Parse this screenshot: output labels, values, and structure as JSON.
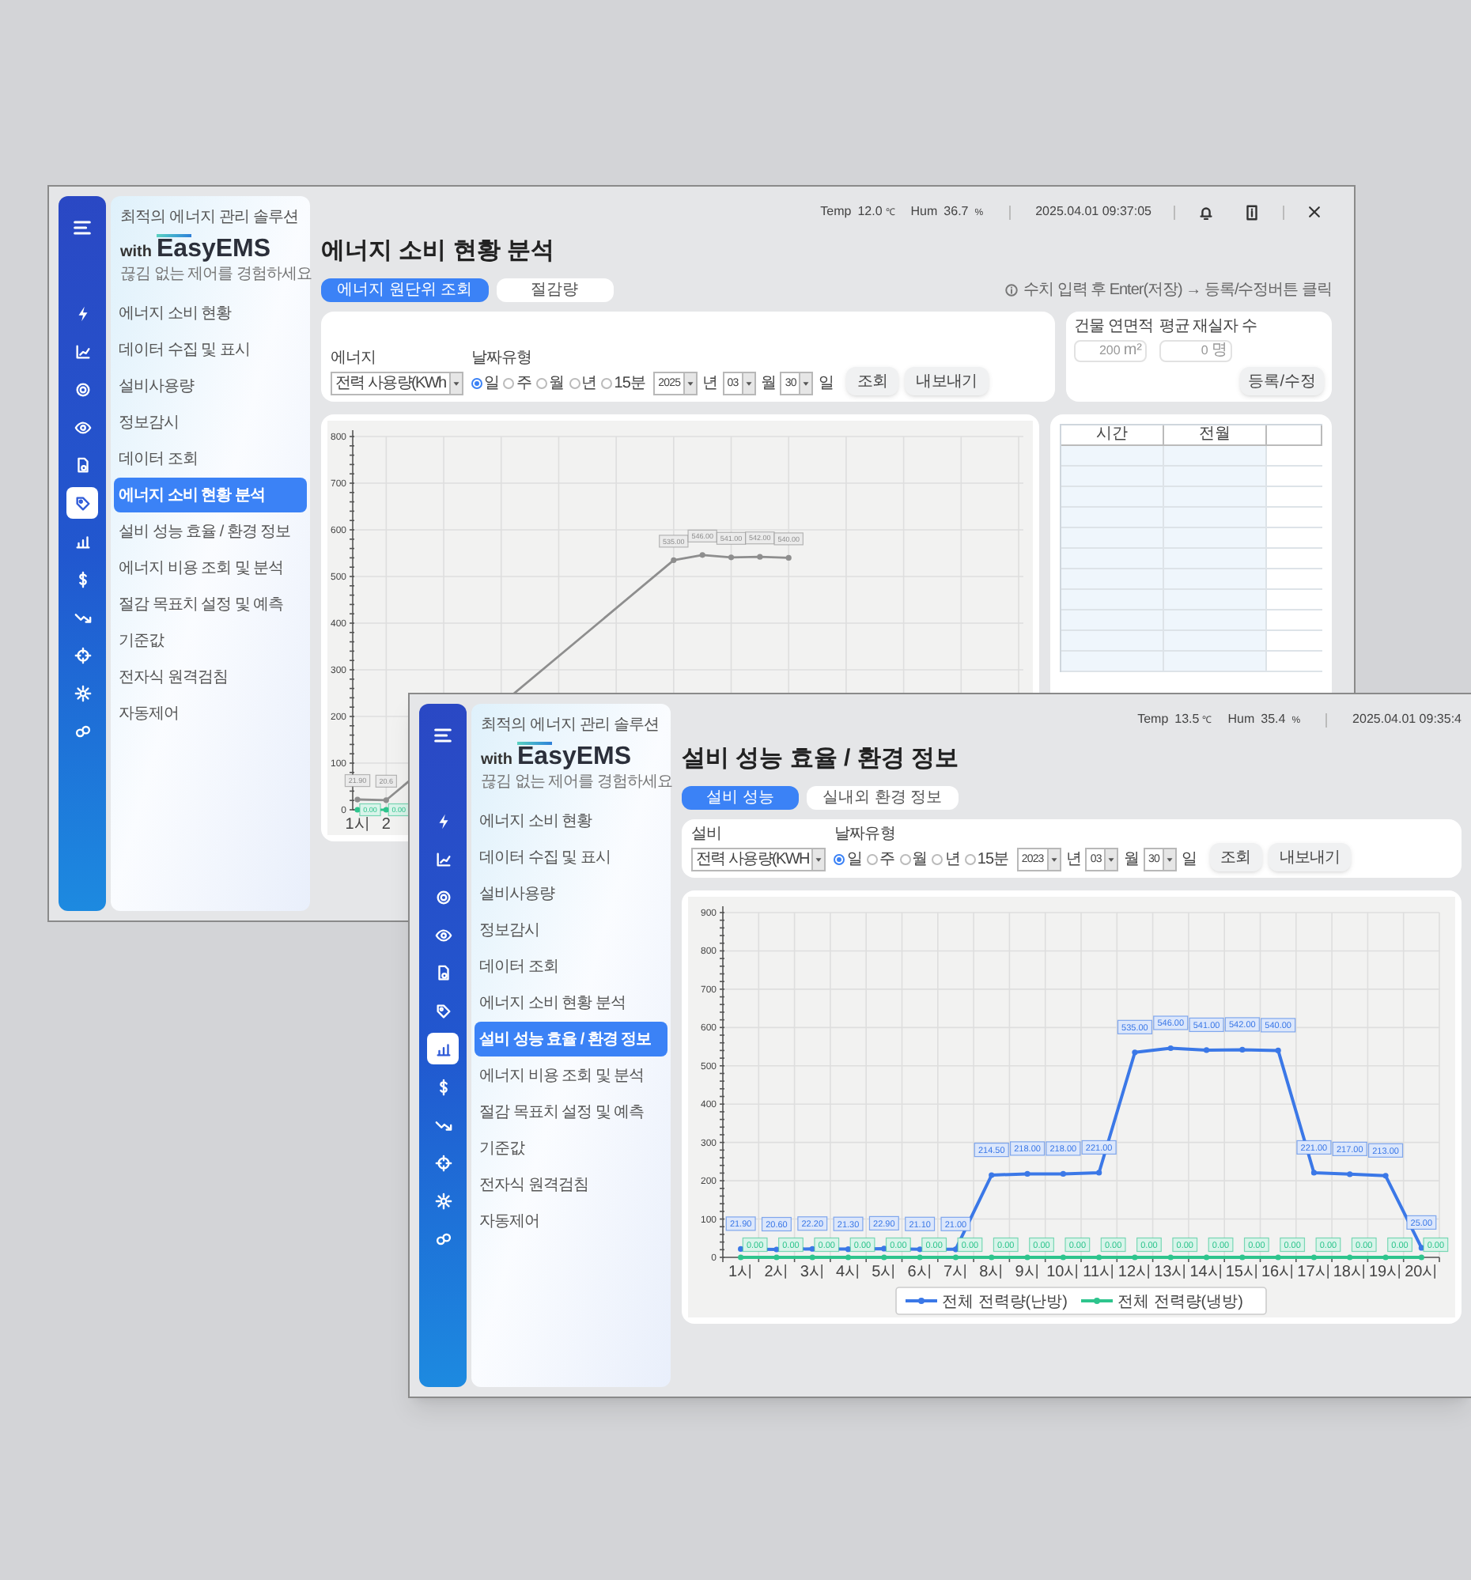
{
  "windows": [
    {
      "kind": "back",
      "status": {
        "temp_label": "Temp",
        "temp": "12.0",
        "temp_unit": "℃",
        "hum_label": "Hum",
        "hum": "36.7",
        "hum_unit": "%",
        "datetime": "2025.04.01 09:37:05"
      },
      "sidebar": {
        "tagline": "최적의 에너지 관리 솔루션",
        "logo_prefix": "with",
        "logo": "EasyEMS",
        "slogan": "끊김 없는 제어를 경험하세요",
        "items": [
          {
            "label": "에너지 소비 현황",
            "selected": false
          },
          {
            "label": "데이터 수집 및 표시",
            "selected": false
          },
          {
            "label": "설비사용량",
            "selected": false
          },
          {
            "label": "정보감시",
            "selected": false
          },
          {
            "label": "데이터 조회",
            "selected": false
          },
          {
            "label": "에너지 소비 현황 분석",
            "selected": true
          },
          {
            "label": "설비 성능 효율 / 환경 정보",
            "selected": false
          },
          {
            "label": "에너지 비용 조회 및 분석",
            "selected": false
          },
          {
            "label": "절감 목표치 설정 및 예측",
            "selected": false
          },
          {
            "label": "기준값",
            "selected": false
          },
          {
            "label": "전자식 원격검침",
            "selected": false
          },
          {
            "label": "자동제어",
            "selected": false
          }
        ]
      },
      "page": {
        "title": "에너지 소비 현황 분석",
        "tabs": [
          {
            "label": "에너지 원단위 조회",
            "selected": true
          },
          {
            "label": "절감량",
            "selected": false
          }
        ],
        "info": "수치 입력 후 Enter(저장) → 등록/수정버튼 클릭",
        "filter": {
          "label": "에너지",
          "select": "전력 사용량(KWh",
          "date_label": "날짜유형",
          "radios": [
            {
              "label": "일",
              "selected": true
            },
            {
              "label": "주",
              "selected": false
            },
            {
              "label": "월",
              "selected": false
            },
            {
              "label": "년",
              "selected": false
            },
            {
              "label": "15분",
              "selected": false
            }
          ],
          "year": "2025",
          "year_unit": "년",
          "month": "03",
          "month_unit": "월",
          "day": "30",
          "day_unit": "일",
          "buttons": [
            "조회",
            "내보내기"
          ]
        },
        "area_panel": {
          "fields": [
            {
              "label": "건물 연면적",
              "value": "200",
              "unit": "m²"
            },
            {
              "label": "평균 재실자 수",
              "value": "0",
              "unit": "명"
            }
          ],
          "button": "등록/수정"
        },
        "chart_panel": {
          "chart_data": {
            "type": "line",
            "grid": true,
            "ylim": [
              0,
              800
            ],
            "yticks": [
              0,
              100,
              200,
              300,
              400,
              500,
              600,
              700,
              800
            ],
            "xlim": [
              1,
              24
            ],
            "x": [
              1,
              2,
              12,
              13,
              14,
              15,
              16
            ],
            "xticks": [
              {
                "value": 1,
                "label": "1시"
              },
              {
                "value": 2,
                "label": "2"
              }
            ],
            "series": [
              {
                "color": "#8e8e8e",
                "marker": "circle",
                "values": [
                  21.9,
                  20.6,
                  535,
                  546,
                  541,
                  542,
                  540
                ],
                "value_labels": [
                  "21.90",
                  "20.6",
                  "535.00",
                  "546.00",
                  "541.00",
                  "542.00",
                  "540.00"
                ]
              },
              {
                "color": "#2ec48d",
                "marker": "circle",
                "values": [
                  0,
                  0,
                  null,
                  null,
                  null,
                  null,
                  null
                ],
                "value_labels": [
                  "0.00",
                  "0.00",
                  null,
                  null,
                  null,
                  null,
                  null
                ]
              }
            ]
          }
        },
        "table": {
          "columns": [
            "시간",
            "전월"
          ]
        }
      }
    },
    {
      "kind": "front",
      "status": {
        "temp_label": "Temp",
        "temp": "13.5",
        "temp_unit": "℃",
        "hum_label": "Hum",
        "hum": "35.4",
        "hum_unit": "%",
        "datetime": "2025.04.01 09:35:4"
      },
      "sidebar": {
        "tagline": "최적의 에너지 관리 솔루션",
        "logo_prefix": "with",
        "logo": "EasyEMS",
        "slogan": "끊김 없는 제어를 경험하세요",
        "items": [
          {
            "label": "에너지 소비 현황",
            "selected": false
          },
          {
            "label": "데이터 수집 및 표시",
            "selected": false
          },
          {
            "label": "설비사용량",
            "selected": false
          },
          {
            "label": "정보감시",
            "selected": false
          },
          {
            "label": "데이터 조회",
            "selected": false
          },
          {
            "label": "에너지 소비 현황 분석",
            "selected": false
          },
          {
            "label": "설비 성능 효율 / 환경 정보",
            "selected": true
          },
          {
            "label": "에너지 비용 조회 및 분석",
            "selected": false
          },
          {
            "label": "절감 목표치 설정 및 예측",
            "selected": false
          },
          {
            "label": "기준값",
            "selected": false
          },
          {
            "label": "전자식 원격검침",
            "selected": false
          },
          {
            "label": "자동제어",
            "selected": false
          }
        ]
      },
      "page": {
        "title": "설비 성능 효율 / 환경 정보",
        "tabs": [
          {
            "label": "설비 성능",
            "selected": true
          },
          {
            "label": "실내외 환경 정보",
            "selected": false
          }
        ],
        "filter": {
          "label": "설비",
          "select": "전력 사용량(KWH",
          "date_label": "날짜유형",
          "radios": [
            {
              "label": "일",
              "selected": true
            },
            {
              "label": "주",
              "selected": false
            },
            {
              "label": "월",
              "selected": false
            },
            {
              "label": "년",
              "selected": false
            },
            {
              "label": "15분",
              "selected": false
            }
          ],
          "year": "2023",
          "year_unit": "년",
          "month": "03",
          "month_unit": "월",
          "day": "30",
          "day_unit": "일",
          "buttons": [
            "조회",
            "내보내기"
          ]
        },
        "chart_panel": {
          "chart_data": {
            "type": "line",
            "grid": true,
            "legend": "bottom",
            "ylim": [
              0,
              900
            ],
            "yticks": [
              0,
              100,
              200,
              300,
              400,
              500,
              600,
              700,
              800,
              900
            ],
            "categories": [
              "1시",
              "2시",
              "3시",
              "4시",
              "5시",
              "6시",
              "7시",
              "8시",
              "9시",
              "10시",
              "11시",
              "12시",
              "13시",
              "14시",
              "15시",
              "16시",
              "17시",
              "18시",
              "19시",
              "20시"
            ],
            "series": [
              {
                "name": "전체 전력량(난방)",
                "color": "#3b78e7",
                "marker": "circle",
                "values": [
                  21.9,
                  20.6,
                  22.2,
                  21.3,
                  22.9,
                  21.1,
                  21.0,
                  214.5,
                  218.0,
                  218.0,
                  221.0,
                  535.0,
                  546.0,
                  541.0,
                  542.0,
                  540.0,
                  221.0,
                  217.0,
                  213.0,
                  25.0
                ],
                "value_labels": [
                  "21.90",
                  "20.60",
                  "22.20",
                  "21.30",
                  "22.90",
                  "21.10",
                  "21.00",
                  "214.50",
                  "218.00",
                  "218.00",
                  "221.00",
                  "535.00",
                  "546.00",
                  "541.00",
                  "542.00",
                  "540.00",
                  "221.00",
                  "217.00",
                  "213.00",
                  "25.00"
                ]
              },
              {
                "name": "전체 전력량(냉방)",
                "color": "#2ec48d",
                "marker": "circle",
                "values": [
                  0,
                  0,
                  0,
                  0,
                  0,
                  0,
                  0,
                  0,
                  0,
                  0,
                  0,
                  0,
                  0,
                  0,
                  0,
                  0,
                  0,
                  0,
                  0,
                  0
                ],
                "value_labels": [
                  "0.00",
                  "0.00",
                  "0.00",
                  "0.00",
                  "0.00",
                  "0.00",
                  "0.00",
                  "0.00",
                  "0.00",
                  "0.00",
                  "0.00",
                  "0.00",
                  "0.00",
                  "0.00",
                  "0.00",
                  "0.00",
                  "0.00",
                  "0.00",
                  "0.00",
                  "0.00"
                ]
              }
            ]
          }
        }
      }
    }
  ]
}
